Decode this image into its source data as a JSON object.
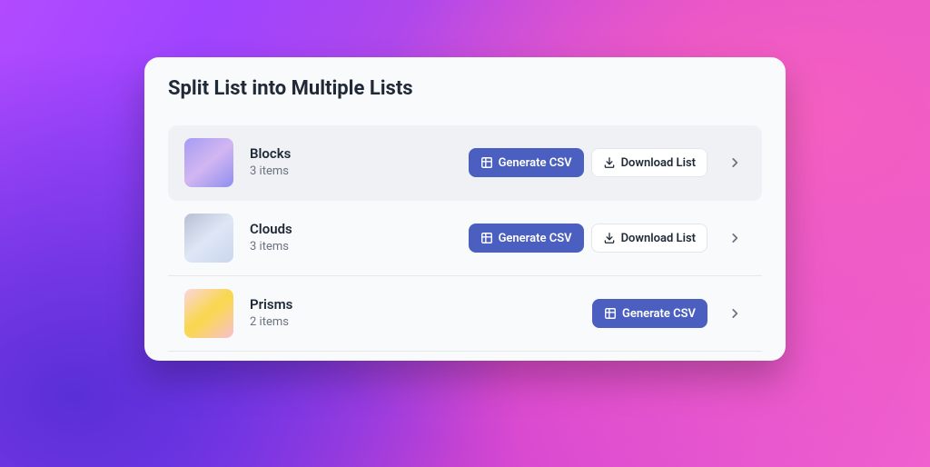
{
  "title": "Split List into Multiple Lists",
  "buttons": {
    "generate": "Generate CSV",
    "download": "Download List"
  },
  "rows": [
    {
      "name": "Blocks",
      "count": "3 items",
      "thumb": "blocks",
      "selected": true,
      "showDownload": true
    },
    {
      "name": "Clouds",
      "count": "3 items",
      "thumb": "clouds",
      "selected": false,
      "showDownload": true
    },
    {
      "name": "Prisms",
      "count": "2 items",
      "thumb": "prisms",
      "selected": false,
      "showDownload": false
    }
  ]
}
